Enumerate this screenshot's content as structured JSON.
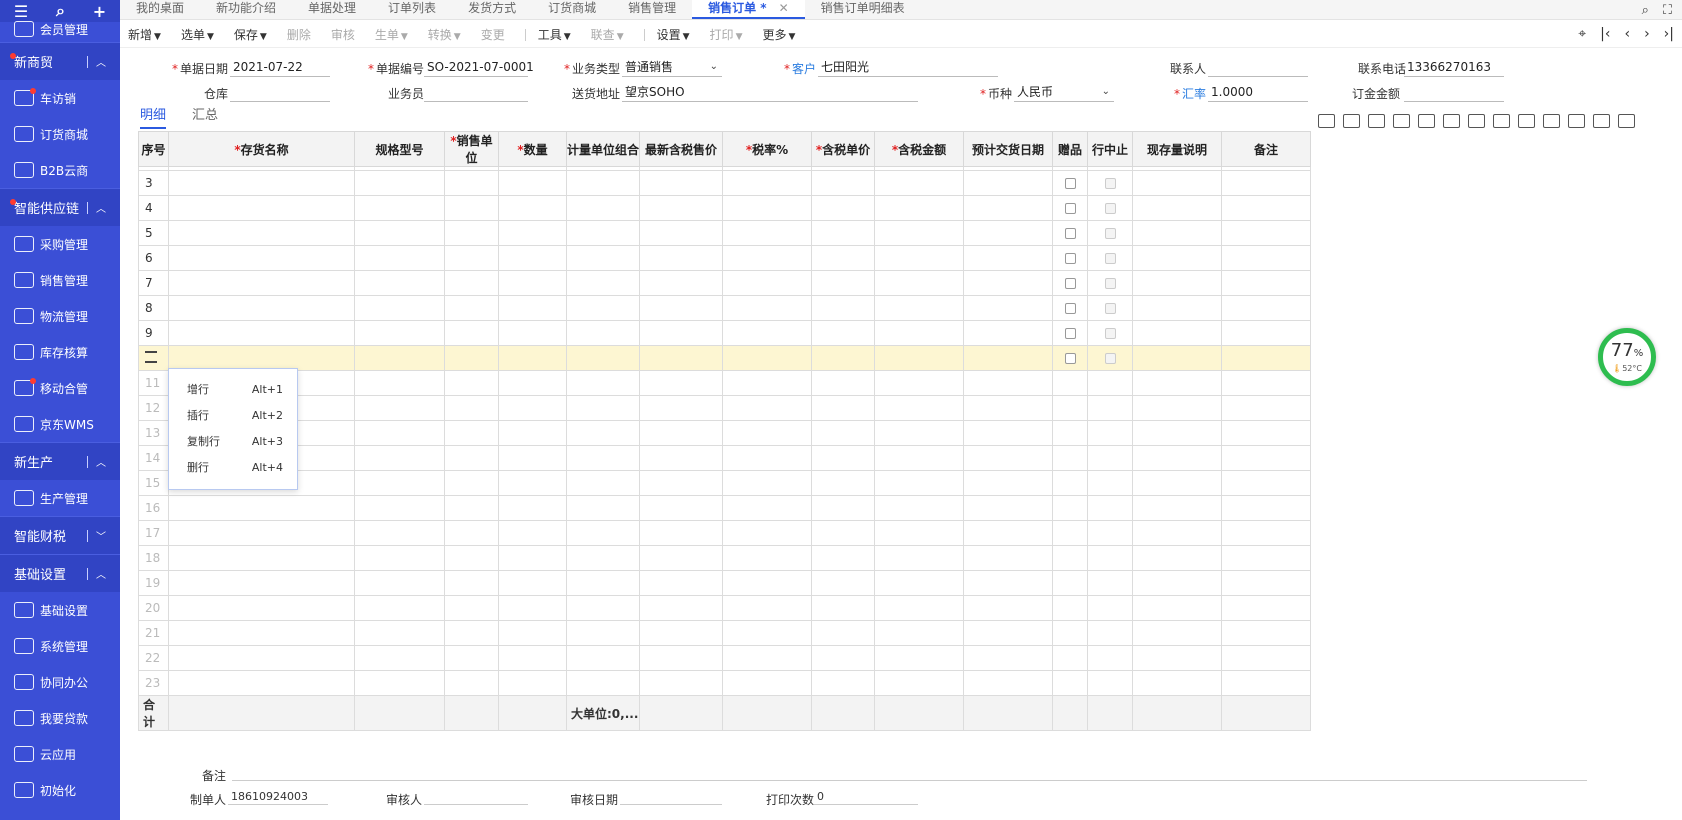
{
  "sidebar": {
    "top_icons": [
      "menu-icon",
      "search-icon",
      "plus-icon"
    ],
    "cut_item": "会员管理",
    "sections": [
      {
        "label": "新商贸",
        "items": [
          "车访销",
          "订货商城",
          "B2B云商"
        ]
      },
      {
        "label": "智能供应链",
        "items": [
          "采购管理",
          "销售管理",
          "物流管理",
          "库存核算",
          "移动合管",
          "京东WMS"
        ]
      },
      {
        "label": "新生产",
        "items": [
          "生产管理"
        ]
      },
      {
        "label": "智能财税",
        "items": []
      },
      {
        "label": "基础设置",
        "items": [
          "基础设置",
          "系统管理",
          "协同办公",
          "我要贷款",
          "云应用",
          "初始化"
        ]
      }
    ]
  },
  "tabs": [
    {
      "label": "我的桌面"
    },
    {
      "label": "新功能介绍"
    },
    {
      "label": "单据处理"
    },
    {
      "label": "订单列表"
    },
    {
      "label": "发货方式"
    },
    {
      "label": "订货商城"
    },
    {
      "label": "销售管理"
    },
    {
      "label": "销售订单 *",
      "active": true
    },
    {
      "label": "销售订单明细表"
    }
  ],
  "toolbar": {
    "items": [
      {
        "label": "新增",
        "dd": true
      },
      {
        "label": "选单",
        "dd": true
      },
      {
        "label": "保存",
        "dd": true
      },
      {
        "label": "删除",
        "disabled": true
      },
      {
        "label": "审核",
        "disabled": true
      },
      {
        "label": "生单",
        "dd": true,
        "disabled": true
      },
      {
        "label": "转换",
        "dd": true,
        "disabled": true
      },
      {
        "label": "变更",
        "disabled": true
      },
      {
        "label": "工具",
        "dd": true
      },
      {
        "label": "联查",
        "dd": true,
        "disabled": true
      },
      {
        "label": "设置",
        "dd": true
      },
      {
        "label": "打印",
        "dd": true,
        "disabled": true
      },
      {
        "label": "更多",
        "dd": true
      }
    ]
  },
  "form": {
    "date_label": "单据日期",
    "date": "2021-07-22",
    "code_label": "单据编号",
    "code": "SO-2021-07-0001",
    "biztype_label": "业务类型",
    "biztype": "普通销售",
    "customer_label": "客户",
    "customer": "七田阳光",
    "contact_label": "联系人",
    "contact": "",
    "phone_label": "联系电话",
    "phone": "13366270163",
    "warehouse_label": "仓库",
    "warehouse": "",
    "salesman_label": "业务员",
    "salesman": "",
    "address_label": "送货地址",
    "address": "望京SOHO",
    "currency_label": "币种",
    "currency": "人民币",
    "rate_label": "汇率",
    "rate": "1.0000",
    "amount_label": "订金金额",
    "amount": ""
  },
  "subtabs": [
    "明细",
    "汇总"
  ],
  "table": {
    "headers": [
      {
        "label": "序号"
      },
      {
        "label": "存货名称",
        "req": true
      },
      {
        "label": "规格型号"
      },
      {
        "label": "销售单位",
        "req": true
      },
      {
        "label": "数量",
        "req": true
      },
      {
        "label": "计量单位组合"
      },
      {
        "label": "最新含税售价"
      },
      {
        "label": "税率%",
        "req": true
      },
      {
        "label": "含税单价",
        "req": true
      },
      {
        "label": "含税金额",
        "req": true
      },
      {
        "label": "预计交货日期"
      },
      {
        "label": "赠品"
      },
      {
        "label": "行中止"
      },
      {
        "label": "现存量说明"
      },
      {
        "label": "备注"
      }
    ],
    "rows": [
      "3",
      "4",
      "5",
      "6",
      "7",
      "8",
      "9",
      "10",
      "11",
      "12",
      "13",
      "14",
      "15",
      "16",
      "17",
      "18",
      "19",
      "20",
      "21",
      "22",
      "23"
    ],
    "total_label": "合计",
    "total_unit": "大单位:0,..."
  },
  "context_menu": [
    {
      "label": "增行",
      "key": "Alt+1"
    },
    {
      "label": "插行",
      "key": "Alt+2"
    },
    {
      "label": "复制行",
      "key": "Alt+3"
    },
    {
      "label": "删行",
      "key": "Alt+4"
    }
  ],
  "footer": {
    "remark_label": "备注",
    "maker_label": "制单人",
    "maker": "18610924003",
    "auditor_label": "审核人",
    "auditor": "",
    "audit_date_label": "审核日期",
    "audit_date": "",
    "print_label": "打印次数",
    "print_count": "0"
  },
  "gauge": {
    "percent": "77",
    "unit": "%",
    "temp": "52°C"
  }
}
